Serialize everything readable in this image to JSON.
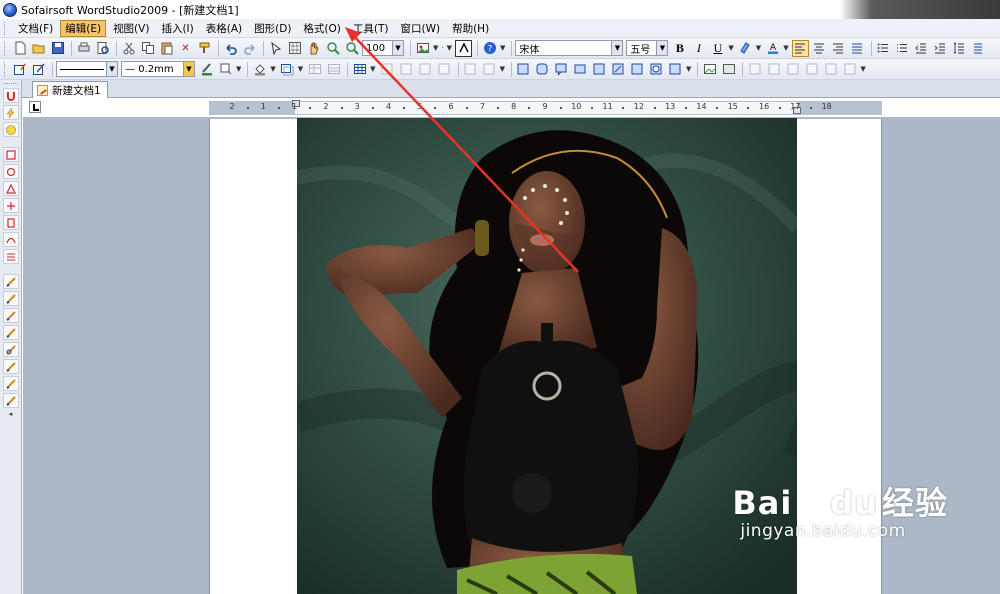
{
  "window": {
    "title": "Sofairsoft WordStudio2009 - [新建文档1]"
  },
  "menu": {
    "items": [
      "文档(F)",
      "编辑(E)",
      "视图(V)",
      "插入(I)",
      "表格(A)",
      "图形(D)",
      "格式(O)",
      "工具(T)",
      "窗口(W)",
      "帮助(H)"
    ],
    "active_index": 1
  },
  "toolbar": {
    "zoom_value": "100",
    "font_name": "宋体",
    "font_size": "五号",
    "bold_label": "B",
    "italic_label": "I",
    "underline_label": "U",
    "line_width": "0.2mm"
  },
  "tabs": {
    "document_tab": "新建文档1"
  },
  "ruler": {
    "labels": [
      "2",
      "1",
      "1",
      "2",
      "3",
      "4",
      "5",
      "6",
      "7",
      "8",
      "9",
      "10",
      "11",
      "12",
      "13",
      "14",
      "15",
      "16",
      "17",
      "18"
    ]
  },
  "watermark": {
    "logo_text_left": "Bai",
    "logo_text_right": "du",
    "logo_text_cn": "经验",
    "url": "jingyan.baidu.com"
  },
  "colors": {
    "menu_active": "#f6c36a",
    "workspace": "#acb8c7",
    "annotation_arrow": "#e8322a"
  }
}
